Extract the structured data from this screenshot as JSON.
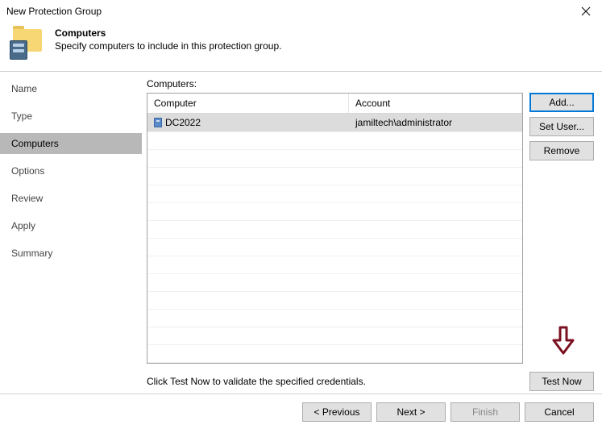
{
  "window": {
    "title": "New Protection Group"
  },
  "header": {
    "heading": "Computers",
    "subheading": "Specify computers to include in this protection group."
  },
  "sidebar": {
    "items": [
      {
        "label": "Name"
      },
      {
        "label": "Type"
      },
      {
        "label": "Computers",
        "active": true
      },
      {
        "label": "Options"
      },
      {
        "label": "Review"
      },
      {
        "label": "Apply"
      },
      {
        "label": "Summary"
      }
    ]
  },
  "content": {
    "list_label": "Computers:",
    "columns": {
      "computer": "Computer",
      "account": "Account"
    },
    "rows": [
      {
        "computer": "DC2022",
        "account": "jamiltech\\administrator",
        "selected": true
      }
    ],
    "hint": "Click Test Now to validate the specified credentials.",
    "buttons": {
      "add": "Add...",
      "set_user": "Set User...",
      "remove": "Remove",
      "test_now": "Test Now"
    }
  },
  "footer": {
    "previous": "< Previous",
    "next": "Next >",
    "finish": "Finish",
    "cancel": "Cancel"
  }
}
